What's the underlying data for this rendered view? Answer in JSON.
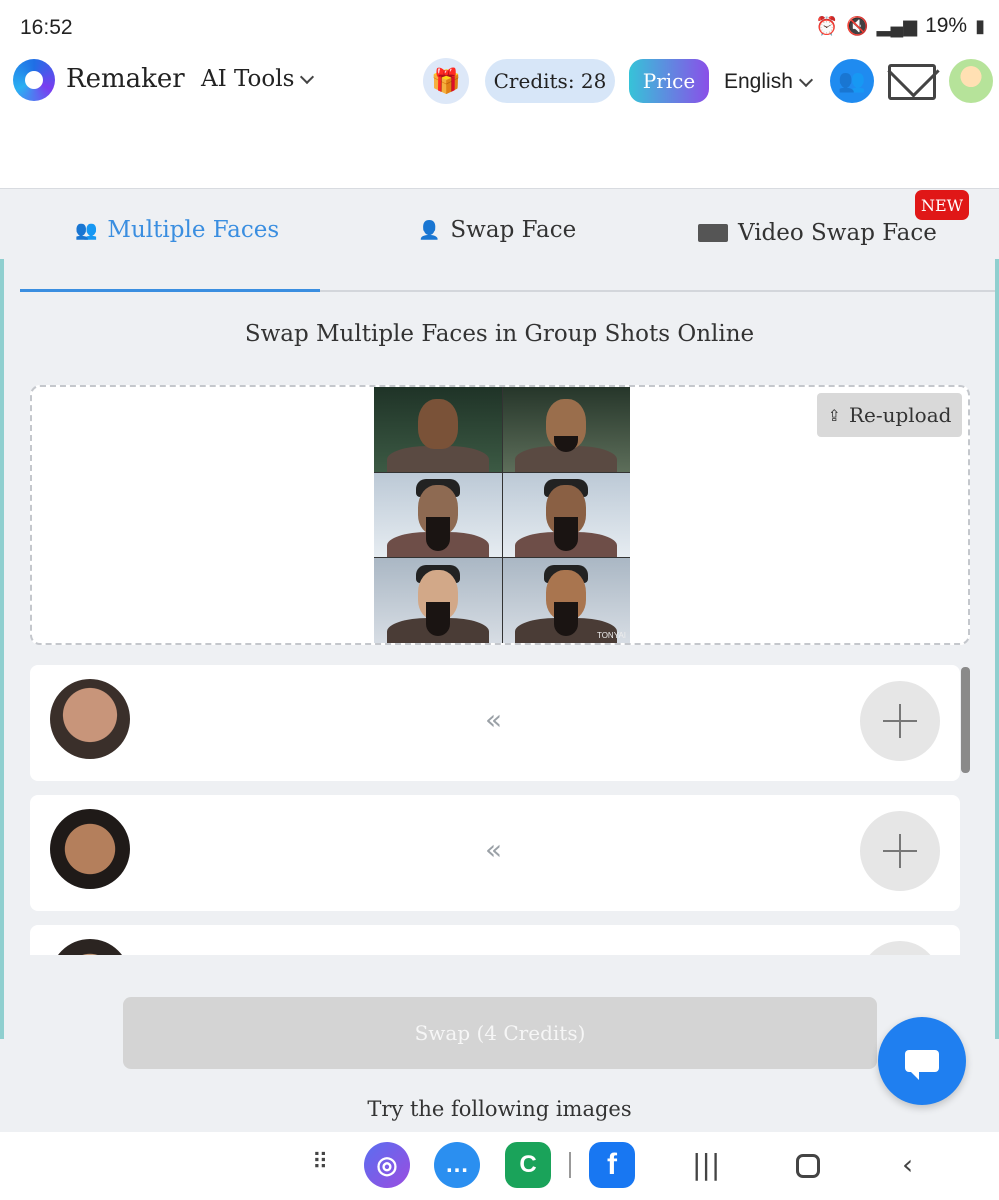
{
  "status_bar": {
    "time": "16:52",
    "battery": "19%"
  },
  "header": {
    "brand": "Remaker",
    "ai_tools": "AI Tools",
    "credits": "Credits: 28",
    "price": "Price",
    "language": "English"
  },
  "tabs": [
    {
      "label": "Multiple Faces",
      "active": true
    },
    {
      "label": "Swap Face",
      "active": false
    },
    {
      "label": "Video Swap Face",
      "active": false
    }
  ],
  "new_badge": "NEW",
  "subtitle": "Swap Multiple Faces in Group Shots Online",
  "uploader": {
    "reupload_label": "Re-upload",
    "watermark": "TONYAI"
  },
  "face_rows": [
    {
      "arrow": "«"
    },
    {
      "arrow": "«"
    },
    {
      "arrow": ""
    }
  ],
  "swap_button": "Swap (4 Credits)",
  "try_text": "Try the following images",
  "colors": {
    "accent": "#3a8ee0",
    "badge": "#e01717",
    "fab": "#1f7ff0"
  }
}
